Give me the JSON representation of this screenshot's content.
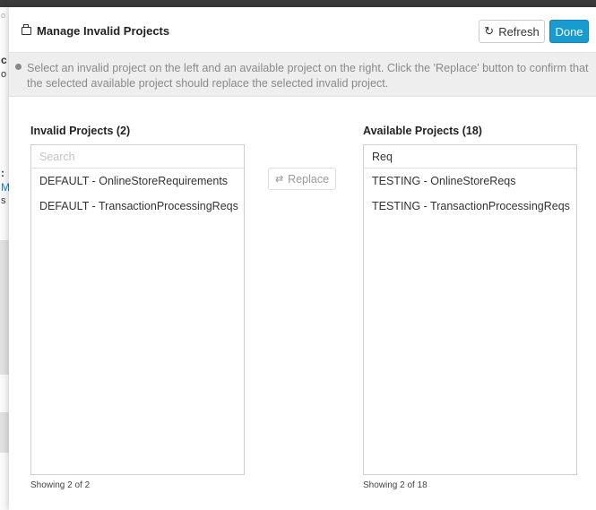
{
  "header": {
    "title": "Manage Invalid Projects",
    "refresh_label": "Refresh",
    "done_label": "Done"
  },
  "info": {
    "text": "Select an invalid project on the left and an available project on the right. Click the 'Replace' button to confirm that the selected available project should replace the selected invalid project."
  },
  "invalid_panel": {
    "title": "Invalid Projects (2)",
    "search_placeholder": "Search",
    "search_value": "",
    "items": [
      "DEFAULT - OnlineStoreRequirements",
      "DEFAULT - TransactionProcessingReqs"
    ],
    "footer": "Showing 2 of 2"
  },
  "available_panel": {
    "title": "Available Projects (18)",
    "search_value": "Req",
    "items": [
      "TESTING - OnlineStoreReqs",
      "TESTING - TransactionProcessingReqs"
    ],
    "footer": "Showing 2 of 18"
  },
  "replace_label": "Replace",
  "background": {
    "fragments": [
      "o",
      "c",
      "o",
      ":",
      "M",
      "s"
    ]
  },
  "colors": {
    "primary": "#1a9bd0",
    "info_bg": "#eeeeee",
    "muted_text": "#8a8a8a"
  },
  "icons": {
    "title": "window-restore-icon",
    "refresh": "refresh-icon",
    "replace": "swap-arrows-icon",
    "info": "info-circle-icon"
  }
}
